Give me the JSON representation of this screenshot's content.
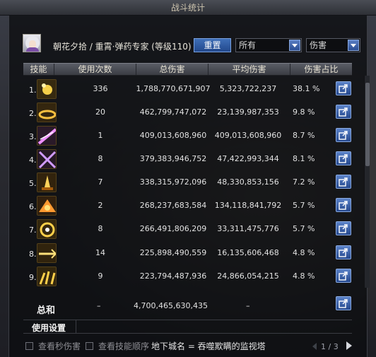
{
  "window": {
    "title": "战斗统计"
  },
  "header": {
    "character_line": "朝花夕拾 / 重霄·弹药专家 (等级110)",
    "reset_label": "重置",
    "mode_select": "所有",
    "stat_select": "伤害"
  },
  "table": {
    "columns": [
      "技能",
      "使用次数",
      "总伤害",
      "平均伤害",
      "伤害占比"
    ],
    "rows": [
      {
        "index": "1.",
        "icon": "bomb-skill-icon",
        "count": "336",
        "total": "1,788,770,671,907",
        "avg": "5,323,722,237",
        "pct": "38.1 %",
        "color": "#d9a221"
      },
      {
        "index": "2.",
        "icon": "ring-barrage-icon",
        "count": "20",
        "total": "462,799,747,072",
        "avg": "23,139,987,353",
        "pct": "9.8 %",
        "color": "#c98a1c"
      },
      {
        "index": "3.",
        "icon": "purple-laser-icon",
        "count": "1",
        "total": "409,013,608,960",
        "avg": "409,013,608,960",
        "pct": "8.7 %",
        "color": "#8e3fc1"
      },
      {
        "index": "4.",
        "icon": "cross-fire-icon",
        "count": "8",
        "total": "379,383,946,752",
        "avg": "47,422,993,344",
        "pct": "8.1 %",
        "color": "#7c3aa8"
      },
      {
        "index": "5.",
        "icon": "rocket-strike-icon",
        "count": "7",
        "total": "338,315,972,096",
        "avg": "48,330,853,156",
        "pct": "7.2 %",
        "color": "#c27a16"
      },
      {
        "index": "6.",
        "icon": "explosion-icon",
        "count": "2",
        "total": "268,237,683,584",
        "avg": "134,118,841,792",
        "pct": "5.7 %",
        "color": "#b9661a"
      },
      {
        "index": "7.",
        "icon": "spin-shot-icon",
        "count": "8",
        "total": "266,491,806,209",
        "avg": "33,311,475,776",
        "pct": "5.7 %",
        "color": "#c8931d"
      },
      {
        "index": "8.",
        "icon": "spear-shot-icon",
        "count": "14",
        "total": "225,898,490,559",
        "avg": "16,135,606,468",
        "pct": "4.8 %",
        "color": "#b77a18"
      },
      {
        "index": "9.",
        "icon": "scatter-shot-icon",
        "count": "9",
        "total": "223,794,487,936",
        "avg": "24,866,054,215",
        "pct": "4.8 %",
        "color": "#c48d1c"
      }
    ],
    "total": {
      "label": "总和",
      "count": "–",
      "total": "4,700,465,630,435",
      "avg": "–"
    }
  },
  "settings": {
    "label": "使用设置"
  },
  "footer": {
    "checkbox_seconds": "查看秒伤害",
    "checkbox_order": "查看技能顺序",
    "dungeon_text": "地下城名 = 吞噬欺瞒的监视塔",
    "pager_text": "1 / 3"
  },
  "colors": {
    "accent": "#2a4d92",
    "panel": "#0c0d10"
  }
}
